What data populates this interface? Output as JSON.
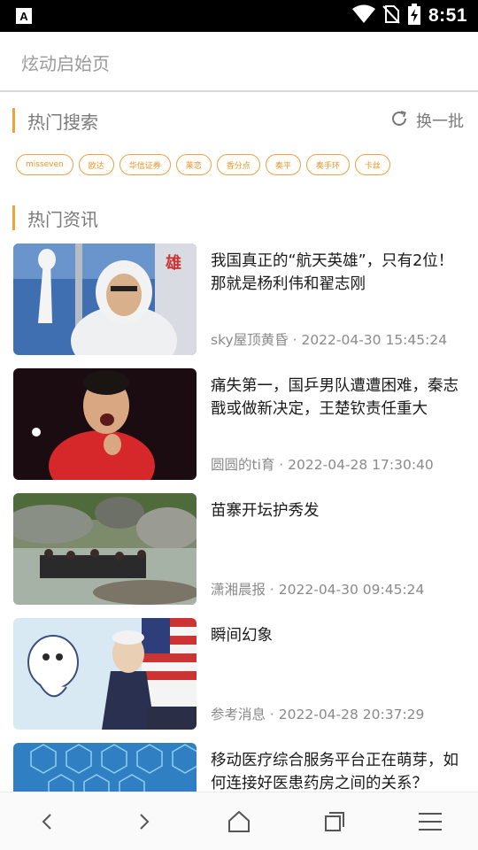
{
  "status_bar": {
    "time": "8:51",
    "left_icon": "a-app-icon",
    "right_icons": [
      "wifi-icon",
      "no-sim-icon",
      "battery-charging-icon"
    ]
  },
  "address_bar": {
    "text": "炫动启始页"
  },
  "hot_search": {
    "title": "热门搜索",
    "refresh_label": "换一批",
    "tags": [
      "misseven",
      "欧达",
      "华信证券",
      "莱恋",
      "香分点",
      "奏平",
      "奏手环",
      "卡丝"
    ]
  },
  "hot_news": {
    "title": "热门资讯",
    "items": [
      {
        "title": "我国真正的“航天英雄”，只有2位！那就是杨利伟和翟志刚",
        "source": "sky屋顶黄昏",
        "time": "2022-04-30 15:45:24",
        "meta": "sky屋顶黄昏 · 2022-04-30 15:45:24"
      },
      {
        "title": "痛失第一，国乒男队遭遭困难，秦志戬或做新决定，王楚钦责任重大",
        "source": "圆圆的ti育",
        "time": "2022-04-28 17:30:40",
        "meta": "圆圆的ti育 · 2022-04-28 17:30:40"
      },
      {
        "title": "苗寨开坛护秀发",
        "source": "潇湘晨报",
        "time": "2022-04-30 09:45:24",
        "meta": "潇湘晨报 · 2022-04-30 09:45:24"
      },
      {
        "title": "瞬间幻象",
        "source": "参考消息",
        "time": "2022-04-28 20:37:29",
        "meta": "参考消息 · 2022-04-28 20:37:29"
      },
      {
        "title": "移动医疗综合服务平台正在萌芽，如何连接好医患药房之间的关系？",
        "source": "",
        "time": "",
        "meta": ""
      }
    ]
  },
  "bottom_nav": {
    "items": [
      "back-icon",
      "forward-icon",
      "home-icon",
      "tabs-icon",
      "menu-icon"
    ]
  },
  "colors": {
    "accent": "#f0a23a",
    "tag_text": "#e8962e",
    "muted_text": "#8a8a8a"
  }
}
